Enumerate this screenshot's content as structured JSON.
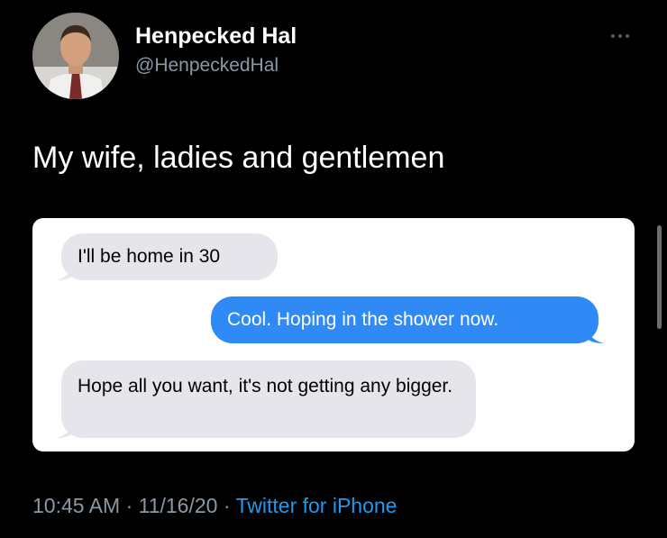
{
  "author": {
    "display_name": "Henpecked Hal",
    "handle": "@HenpeckedHal"
  },
  "tweet": {
    "text": "My wife, ladies and gentlemen"
  },
  "screenshot": {
    "messages": [
      {
        "direction": "received",
        "text": "I'll be home in 30"
      },
      {
        "direction": "sent",
        "text": "Cool. Hoping in the shower now."
      },
      {
        "direction": "received",
        "text": "Hope all you want, it's not getting any bigger."
      }
    ]
  },
  "meta": {
    "timestamp": "10:45 AM · 11/16/20",
    "separator": "·",
    "source": "Twitter for iPhone"
  },
  "colors": {
    "background": "#000000",
    "sent_bubble": "#2f8af5",
    "received_bubble": "#e6e5eb",
    "link": "#1d9bf0",
    "muted": "#8b98a5"
  },
  "icons": {
    "menu": "more-horizontal-icon",
    "avatar": "profile-avatar"
  }
}
